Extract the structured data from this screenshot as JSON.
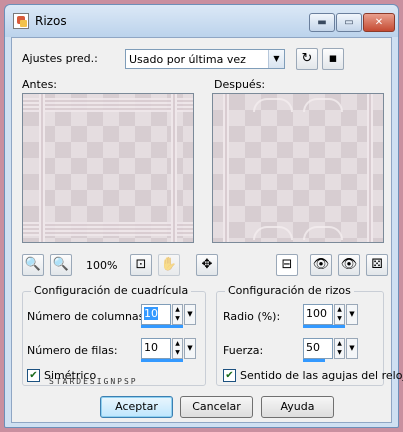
{
  "window": {
    "title": "Rizos",
    "controls": {
      "minimize": "▬",
      "maximize": "▭",
      "close": "✕"
    }
  },
  "presets": {
    "label": "Ajustes pred.:",
    "value": "Usado por última vez"
  },
  "previews": {
    "before_label": "Antes:",
    "after_label": "Después:"
  },
  "zoom": {
    "value": "100%"
  },
  "grid_config": {
    "title": "Configuración de cuadrícula",
    "columns_label": "Número de columnas:",
    "columns_value": "10",
    "rows_label": "Número de filas:",
    "rows_value": "10",
    "symmetric_label": "Simétrico",
    "symmetric_checked": true
  },
  "curl_config": {
    "title": "Configuración de rizos",
    "radius_label": "Radio (%):",
    "radius_value": "100",
    "strength_label": "Fuerza:",
    "strength_value": "50",
    "clockwise_label": "Sentido de las agujas del reloj",
    "clockwise_checked": true
  },
  "buttons": {
    "accept": "Aceptar",
    "cancel": "Cancelar",
    "help": "Ayuda"
  },
  "watermark": "STARDESIGNPSP"
}
